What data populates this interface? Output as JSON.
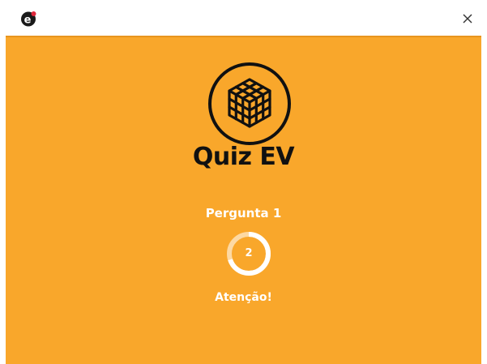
{
  "header": {
    "logo_icon": "e-logo-icon",
    "close_icon": "close-icon",
    "close_glyph": "✕"
  },
  "quiz": {
    "icon": "rubiks-cube-icon",
    "title": "Quiz EV",
    "question_label": "Pergunta 1",
    "timer_value": "2",
    "timer_progress": 0.8,
    "status_text": "Atenção!"
  },
  "colors": {
    "panel_background": "#f9a72b",
    "title_text": "#111111",
    "label_text": "#ffffff",
    "logo_accent": "#e0283c"
  }
}
